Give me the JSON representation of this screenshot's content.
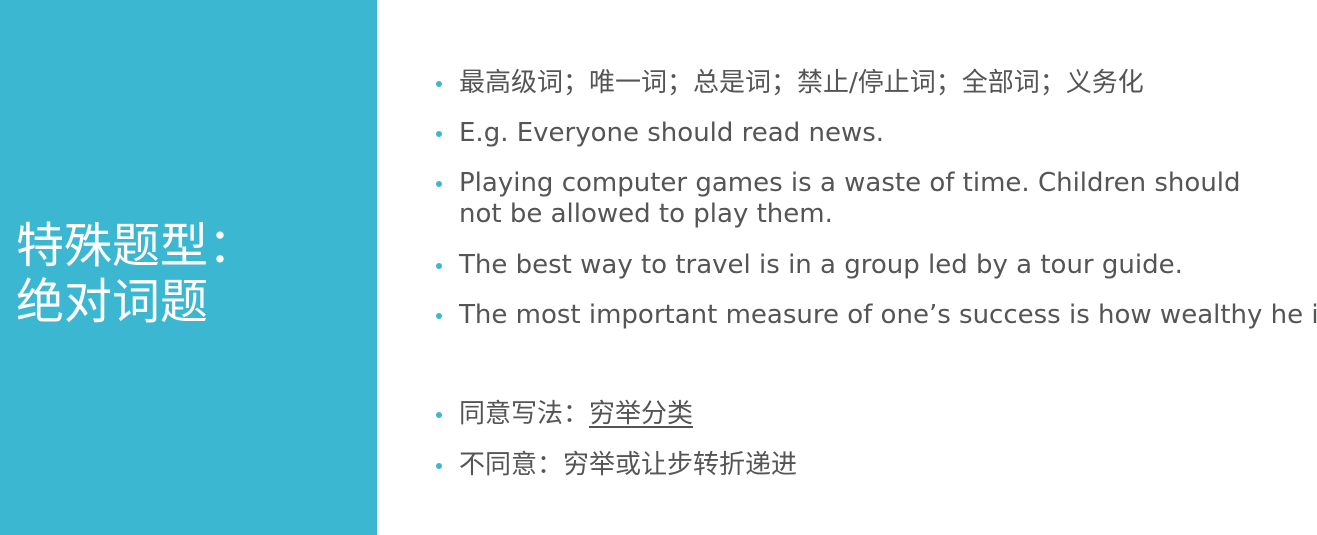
{
  "side": {
    "title_line1": "特殊题型：",
    "title_line2": "绝对词题"
  },
  "bullets": {
    "b1": "最高级词；唯一词；总是词；禁止/停止词；全部词；义务化",
    "b2": "E.g. Everyone should read news.",
    "b3": "Playing computer games is a waste of time. Children should not be allowed to play them.",
    "b4": "The best way to travel is in a group led by a tour guide.",
    "b5": "The most important measure of one’s success is how wealthy he is.",
    "b6_prefix": "同意写法：",
    "b6_link": "穷举分类",
    "b7": "不同意：穷举或让步转折递进"
  },
  "colors": {
    "accent": "#3cb7d2",
    "text": "#555555",
    "title": "#ffffff"
  }
}
